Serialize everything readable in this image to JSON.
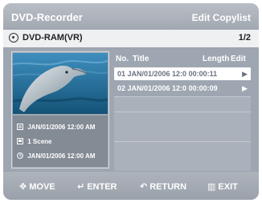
{
  "header": {
    "title": "DVD-Recorder",
    "mode": "Edit Copylist"
  },
  "disc": {
    "label": "DVD-RAM(VR)",
    "page": "1/2",
    "icon": "disc-icon"
  },
  "thumbnail": {
    "subject": "dolphin"
  },
  "info": [
    {
      "icon": "record-date-icon",
      "text": "JAN/01/2006 12:00 AM"
    },
    {
      "icon": "scene-icon",
      "text": "1 Scene"
    },
    {
      "icon": "clock-icon",
      "text": "JAN/01/2006 12:00 AM"
    }
  ],
  "table": {
    "columns": {
      "no": "No.",
      "title": "Title",
      "length": "Length",
      "edit": "Edit"
    },
    "rows": [
      {
        "text": "01 JAN/01/2006 12:0 00:00:11",
        "selected": true
      },
      {
        "text": "02 JAN/01/2006 12:0 00:00:09",
        "selected": false
      }
    ]
  },
  "footer": {
    "move": "MOVE",
    "enter": "ENTER",
    "return": "RETURN",
    "exit": "EXIT"
  },
  "colors": {
    "panel": "#9ea6b1",
    "highlight": "#ffffff",
    "header": "#aab0b8"
  }
}
